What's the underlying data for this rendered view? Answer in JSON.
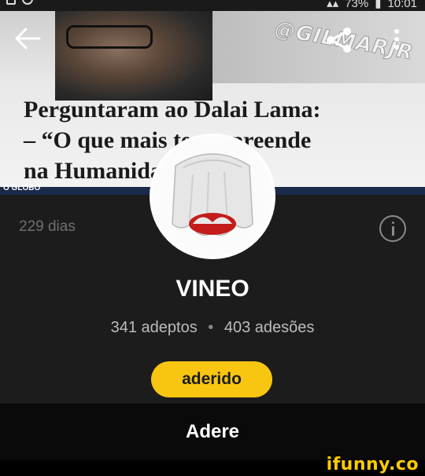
{
  "status_bar": {
    "battery": "73%",
    "time": "10:01"
  },
  "cover": {
    "quote_lines": [
      "Perguntaram ao Dalai Lama:",
      "– “O que mais te surpreende",
      "na Humanidade?"
    ],
    "tv_logo": "O GLOBO",
    "watermark": "@GILMARJR"
  },
  "profile": {
    "days": "229 dias",
    "name": "VINEO",
    "followers": "341 adeptos",
    "separator": "•",
    "joins": "403 adesões",
    "joined_button": "aderido",
    "join_bar": "Adere"
  },
  "footer": {
    "brand": "ifunny.co"
  },
  "colors": {
    "accent": "#f8c610",
    "panel": "#1c1c1c"
  },
  "icons": [
    "back-arrow-icon",
    "share-icon",
    "more-vertical-icon",
    "info-icon"
  ]
}
